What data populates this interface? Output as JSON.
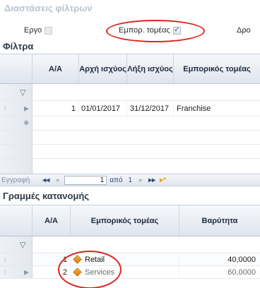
{
  "dimensions": {
    "title": "Διαστάσεις φίλτρων",
    "items": [
      {
        "label": "Εργο",
        "checked": false
      },
      {
        "label": "Εμπορ. τομέας",
        "checked": true,
        "check_glyph": "✓"
      },
      {
        "label": "Δρο"
      }
    ]
  },
  "filters": {
    "title": "Φίλτρα",
    "columns": [
      "Α/Α",
      "Αρχή ισχύος",
      "Λήξη ισχύος",
      "Εμπορικός τομέας"
    ],
    "rows": [
      {
        "aa": "1",
        "start": "01/01/2017",
        "end": "31/12/2017",
        "sector": "Franchise"
      }
    ]
  },
  "pager": {
    "label": "Εγγραφή",
    "first": "◂◂",
    "prev": "◂",
    "current": "1",
    "of": "από",
    "total": "1",
    "next": "▸",
    "last": "▸▸",
    "add": "▸*"
  },
  "allocation": {
    "title": "Γραμμές κατανομής",
    "columns": [
      "Α/Α",
      "Εμπορικός τομέας",
      "Βαρύτητα"
    ],
    "rows": [
      {
        "aa": "1",
        "sector": "Retail",
        "weight": "40,0000"
      },
      {
        "aa": "2",
        "sector": "Services",
        "weight": "60,0000"
      }
    ]
  },
  "icons": {
    "filter": "filter-icon",
    "row_indicator": "row-indicator-icon",
    "new_row": "new-row-icon",
    "sector": "sector-diamond-icon"
  },
  "colors": {
    "highlight": "#e0241c",
    "header_text": "#1c2a40",
    "pager_text": "#2d4a7a"
  }
}
